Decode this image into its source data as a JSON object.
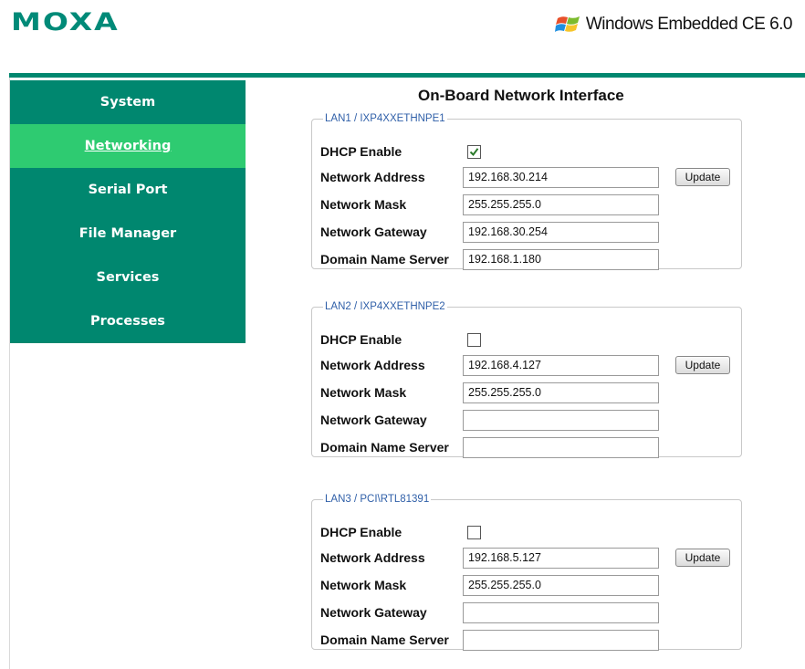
{
  "header": {
    "brand": "MOXA",
    "os_label": "Windows Embedded CE 6.0",
    "os_icon": "windows-flag-icon"
  },
  "colors": {
    "brand": "#008a78",
    "sidebar": "#00876f",
    "active": "#2ecb71",
    "legend": "#2f5fa8"
  },
  "sidebar": {
    "items": [
      {
        "label": "System"
      },
      {
        "label": "Networking",
        "active": true
      },
      {
        "label": "Serial Port"
      },
      {
        "label": "File Manager"
      },
      {
        "label": "Services"
      },
      {
        "label": "Processes"
      }
    ]
  },
  "main": {
    "title": "On-Board Network Interface",
    "labels": {
      "dhcp": "DHCP Enable",
      "address": "Network Address",
      "mask": "Network Mask",
      "gateway": "Network Gateway",
      "dns": "Domain Name Server",
      "update": "Update"
    },
    "lans": [
      {
        "legend": "LAN1 / IXP4XXETHNPE1",
        "dhcp": true,
        "address": "192.168.30.214",
        "mask": "255.255.255.0",
        "gateway": "192.168.30.254",
        "dns": "192.168.1.180"
      },
      {
        "legend": "LAN2 / IXP4XXETHNPE2",
        "dhcp": false,
        "address": "192.168.4.127",
        "mask": "255.255.255.0",
        "gateway": "",
        "dns": ""
      },
      {
        "legend": "LAN3 / PCI\\RTL81391",
        "dhcp": false,
        "address": "192.168.5.127",
        "mask": "255.255.255.0",
        "gateway": "",
        "dns": ""
      }
    ]
  }
}
